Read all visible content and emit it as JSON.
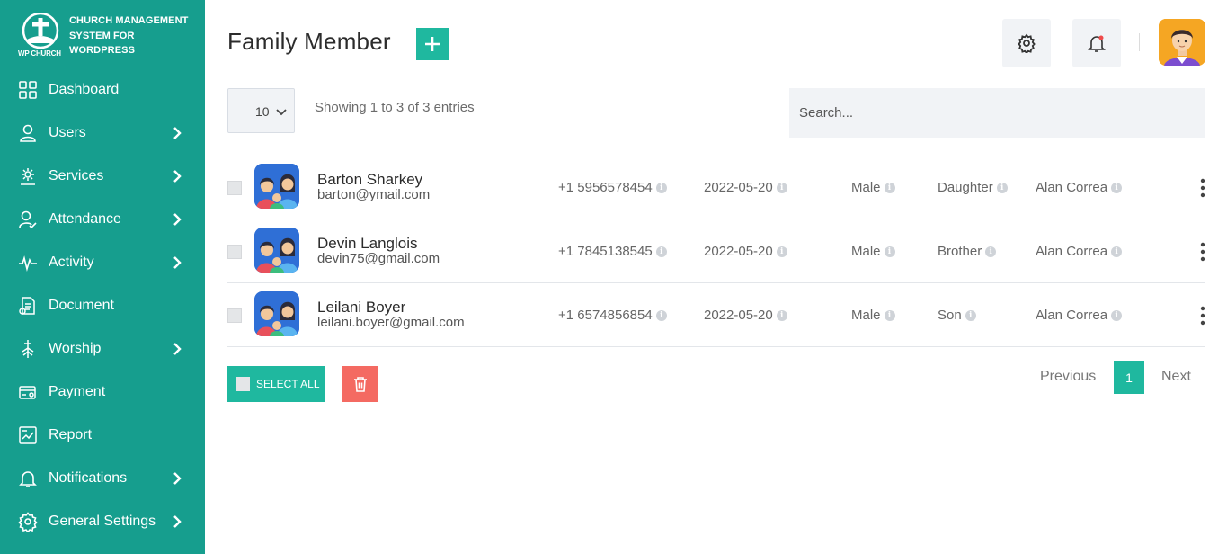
{
  "brand": {
    "logo_text": "WP CHURCH",
    "title_lines": [
      "CHURCH MANAGEMENT",
      "SYSTEM FOR",
      "WORDPRESS"
    ]
  },
  "sidebar": {
    "items": [
      {
        "label": "Dashboard",
        "icon": "dashboard-icon",
        "has_submenu": false
      },
      {
        "label": "Users",
        "icon": "user-icon",
        "has_submenu": true
      },
      {
        "label": "Services",
        "icon": "services-icon",
        "has_submenu": true
      },
      {
        "label": "Attendance",
        "icon": "attendance-icon",
        "has_submenu": true
      },
      {
        "label": "Activity",
        "icon": "activity-icon",
        "has_submenu": true
      },
      {
        "label": "Document",
        "icon": "document-icon",
        "has_submenu": false
      },
      {
        "label": "Worship",
        "icon": "worship-icon",
        "has_submenu": true
      },
      {
        "label": "Payment",
        "icon": "payment-icon",
        "has_submenu": false
      },
      {
        "label": "Report",
        "icon": "report-icon",
        "has_submenu": false
      },
      {
        "label": "Notifications",
        "icon": "bell-icon",
        "has_submenu": true
      },
      {
        "label": "General Settings",
        "icon": "gear-icon",
        "has_submenu": true
      }
    ]
  },
  "header": {
    "title": "Family Member",
    "add_icon": "plus-icon",
    "settings_icon": "gear-icon",
    "notification_icon": "bell-icon",
    "avatar_icon": "user-avatar"
  },
  "table_controls": {
    "page_size": "10",
    "showing": "Showing 1 to 3 of 3 entries",
    "search_placeholder": "Search..."
  },
  "members": [
    {
      "name": "Barton Sharkey",
      "email": "barton@ymail.com",
      "phone": "+1 5956578454",
      "date": "2022-05-20",
      "gender": "Male",
      "relation": "Daughter",
      "head": "Alan Correa"
    },
    {
      "name": "Devin Langlois",
      "email": "devin75@gmail.com",
      "phone": "+1 7845138545",
      "date": "2022-05-20",
      "gender": "Male",
      "relation": "Brother",
      "head": "Alan Correa"
    },
    {
      "name": "Leilani Boyer",
      "email": "leilani.boyer@gmail.com",
      "phone": "+1 6574856854",
      "date": "2022-05-20",
      "gender": "Male",
      "relation": "Son",
      "head": "Alan Correa"
    }
  ],
  "footer": {
    "select_all": "SELECT ALL",
    "delete_icon": "trash-icon",
    "previous": "Previous",
    "current_page": "1",
    "next": "Next"
  },
  "colors": {
    "sidebar": "#169e8e",
    "accent": "#1fb89f",
    "danger": "#f46a62",
    "panel": "#f1f3f6"
  }
}
